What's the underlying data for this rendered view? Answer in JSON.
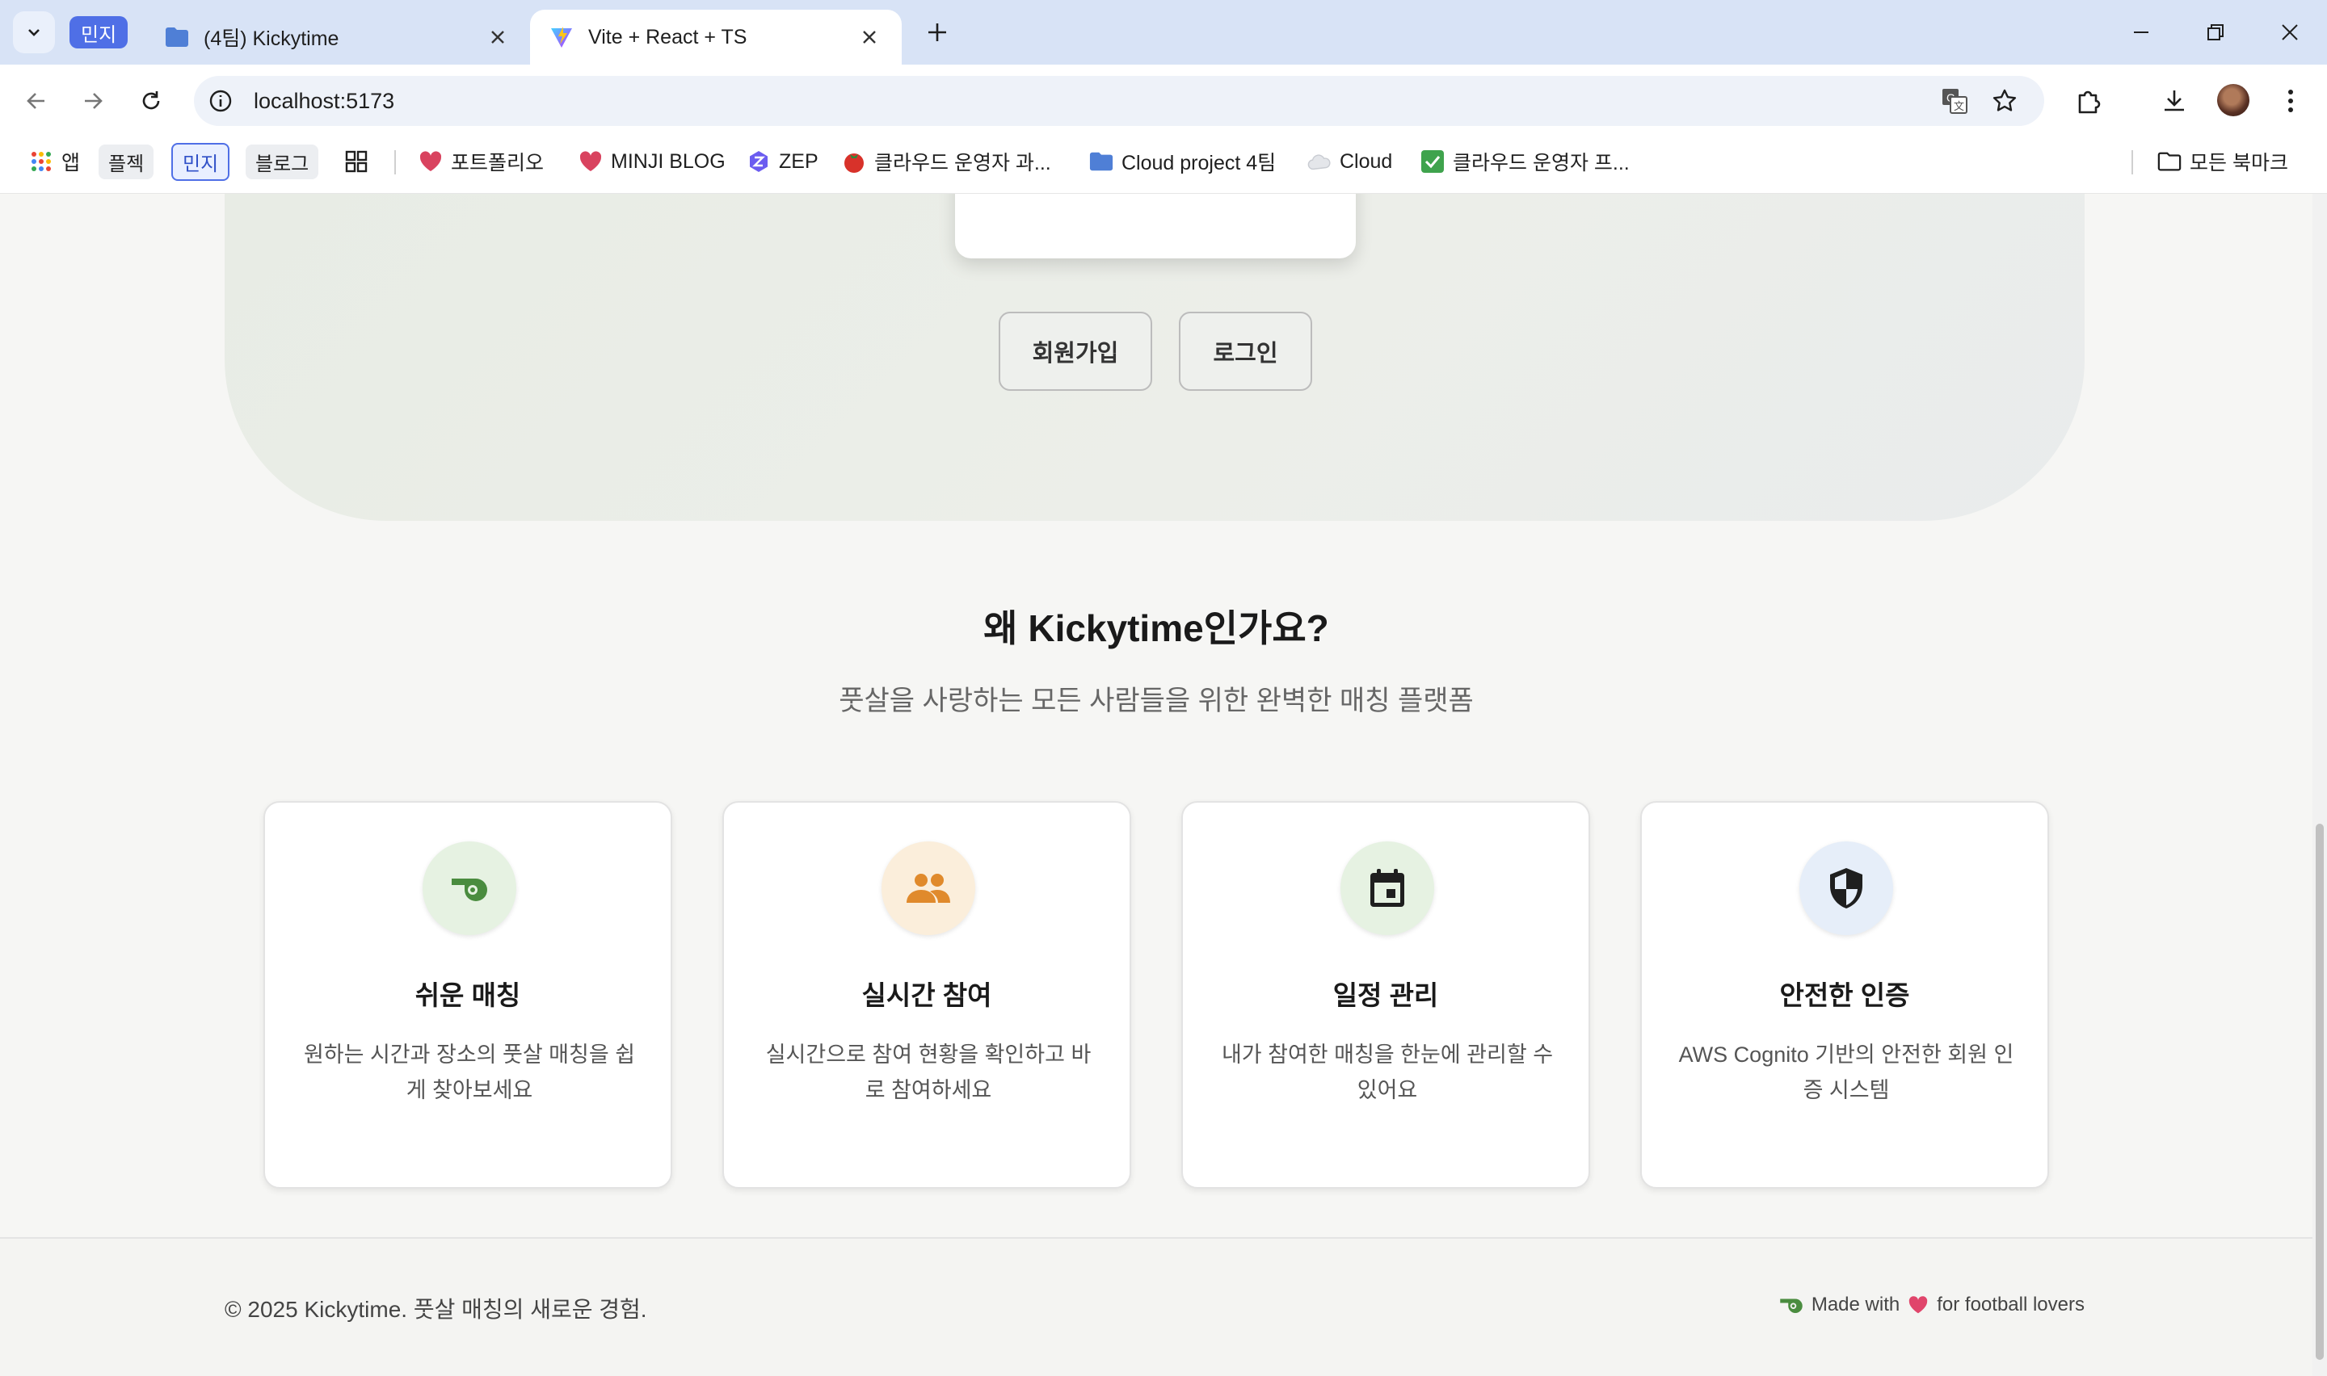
{
  "browser": {
    "tab_group_label": "민지",
    "tabs": [
      {
        "title": "(4팀) Kickytime",
        "active": false
      },
      {
        "title": "Vite + React + TS",
        "active": true
      }
    ],
    "url": "localhost:5173",
    "bookmarks": [
      {
        "label": "앱",
        "icon": "apps-grid-icon"
      },
      {
        "label": "플젝",
        "icon": "chip"
      },
      {
        "label": "민지",
        "icon": "chip"
      },
      {
        "label": "블로그",
        "icon": "chip"
      },
      {
        "label": "",
        "icon": "grid-icon"
      },
      {
        "label": "포트폴리오",
        "icon": "heart-icon"
      },
      {
        "label": "MINJI BLOG",
        "icon": "heart-icon"
      },
      {
        "label": "ZEP",
        "icon": "zep-icon"
      },
      {
        "label": "클라우드 운영자 과...",
        "icon": "tomato-icon"
      },
      {
        "label": "Cloud project 4팀",
        "icon": "folder-icon"
      },
      {
        "label": "Cloud",
        "icon": "cloud-icon"
      },
      {
        "label": "클라우드 운영자 프...",
        "icon": "checkbox-icon"
      }
    ],
    "all_bookmarks": "모든 북마크"
  },
  "hero": {
    "signup_label": "회원가입",
    "login_label": "로그인"
  },
  "why": {
    "title": "왜 Kickytime인가요?",
    "subtitle": "풋살을 사랑하는 모든 사람들을 위한 완벽한 매칭 플랫폼"
  },
  "features": [
    {
      "title": "쉬운 매칭",
      "desc": "원하는 시간과 장소의 풋살 매칭을 쉽게 찾아보세요",
      "icon": "whistle-icon",
      "bg": "#e6f2e2",
      "color": "#4a8c3f"
    },
    {
      "title": "실시간 참여",
      "desc": "실시간으로 참여 현황을 확인하고 바로 참여하세요",
      "icon": "people-icon",
      "bg": "#fbeedb",
      "color": "#e08a2c"
    },
    {
      "title": "일정 관리",
      "desc": "내가 참여한 매칭을 한눈에 관리할 수 있어요",
      "icon": "calendar-icon",
      "bg": "#e6f2e2",
      "color": "#1f1f1f"
    },
    {
      "title": "안전한 인증",
      "desc": "AWS Cognito 기반의 안전한 회원 인증 시스템",
      "icon": "shield-icon",
      "bg": "#e6eef9",
      "color": "#1f1f1f"
    }
  ],
  "footer": {
    "copyright": "© 2025 Kickytime. 풋살 매칭의 새로운 경험.",
    "made_with": "Made with",
    "for_text": "for football lovers"
  },
  "colors": {
    "accent_green": "#5da14f",
    "heart": "#e0456b",
    "tab_group": "#4f6fe6"
  }
}
